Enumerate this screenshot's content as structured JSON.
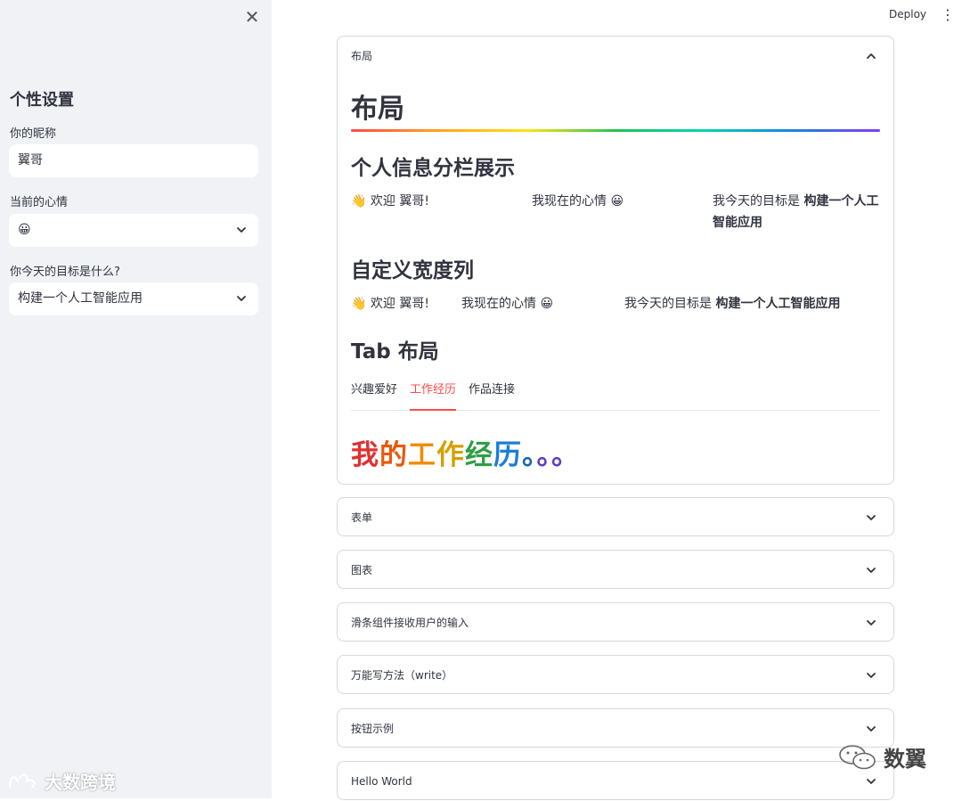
{
  "sidebar": {
    "title": "个性设置",
    "nickname_label": "你的昵称",
    "nickname_value": "翼哥",
    "mood_label": "当前的心情",
    "mood_value": "😀",
    "goal_label": "你今天的目标是什么?",
    "goal_value": "构建一个人工智能应用",
    "watermark": "大数跨境"
  },
  "topbar": {
    "deploy_label": "Deploy"
  },
  "layout_expander": {
    "header": "布局",
    "title": "布局",
    "section1_title": "个人信息分栏展示",
    "section1_col1": "👋 欢迎 翼哥!",
    "section1_col2": "我现在的心情 😀",
    "section1_col3_prefix": "我今天的目标是 ",
    "section1_col3_bold": "构建一个人工智能应用",
    "section2_title": "自定义宽度列",
    "section2_col1": "👋 欢迎 翼哥!",
    "section2_col2": "我现在的心情 😀",
    "section2_col3_prefix": "我今天的目标是 ",
    "section2_col3_bold": "构建一个人工智能应用",
    "section3_title": "Tab 布局",
    "tabs": [
      "兴趣爱好",
      "工作经历",
      "作品连接"
    ],
    "active_tab": "工作经历",
    "tab_content": "我的工作经历。。。"
  },
  "expanders": [
    "表单",
    "图表",
    "滑条组件接收用户的输入",
    "万能写方法（write）",
    "按钮示例",
    "Hello World"
  ],
  "watermark_right": "数翼",
  "colors": {
    "accent": "#ff4b4b",
    "sidebar_bg": "#f0f2f6",
    "text": "#31333f",
    "border": "#d6d8dd"
  }
}
